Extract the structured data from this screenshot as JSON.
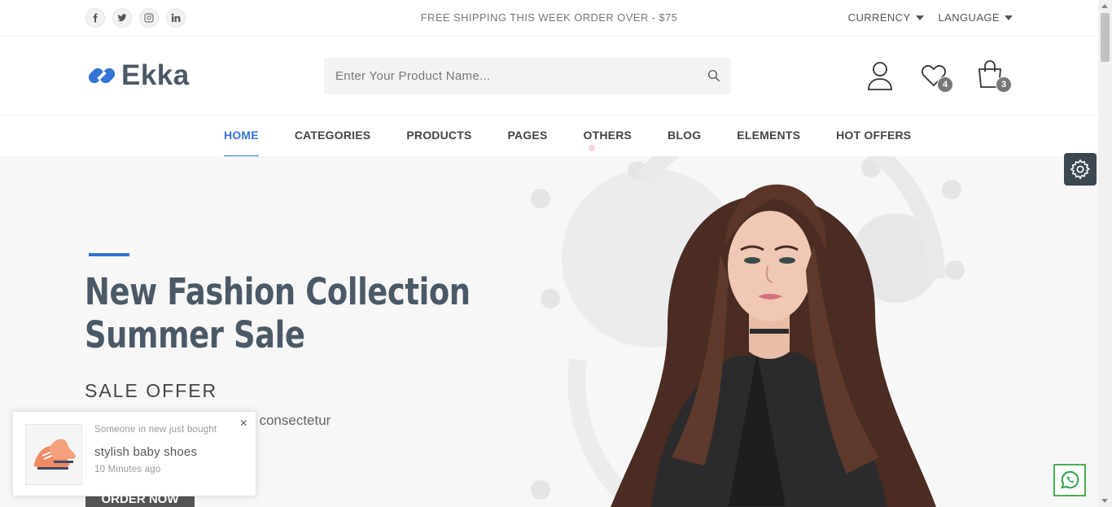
{
  "topbar": {
    "social": [
      {
        "icon": "facebook-icon"
      },
      {
        "icon": "twitter-icon"
      },
      {
        "icon": "instagram-icon"
      },
      {
        "icon": "linkedin-icon"
      }
    ],
    "promo": "FREE SHIPPING THIS WEEK ORDER OVER - $75",
    "currency_label": "CURRENCY",
    "language_label": "LANGUAGE"
  },
  "header": {
    "logo_text": "Ekka",
    "search_placeholder": "Enter Your Product Name...",
    "wishlist_count": "4",
    "cart_count": "3"
  },
  "nav": {
    "items": [
      "HOME",
      "CATEGORIES",
      "PRODUCTS",
      "PAGES",
      "OTHERS",
      "BLOG",
      "ELEMENTS",
      "HOT OFFERS"
    ],
    "active": "HOME"
  },
  "hero": {
    "title_line1": "New Fashion Collection",
    "title_line2": "Summer Sale",
    "subtitle": "SALE OFFER",
    "text": "Lorem ipsum dolor sit amet, consectetur",
    "button": "ORDER NOW"
  },
  "toast": {
    "line1": "Someone in new just bought",
    "product": "stylish baby shoes",
    "time": "10 Minutes ago",
    "close": "×"
  },
  "colors": {
    "accent": "#3474d4",
    "text": "#4b5966",
    "hero_bg": "#f7f7f8",
    "whatsapp": "#4caf50"
  }
}
